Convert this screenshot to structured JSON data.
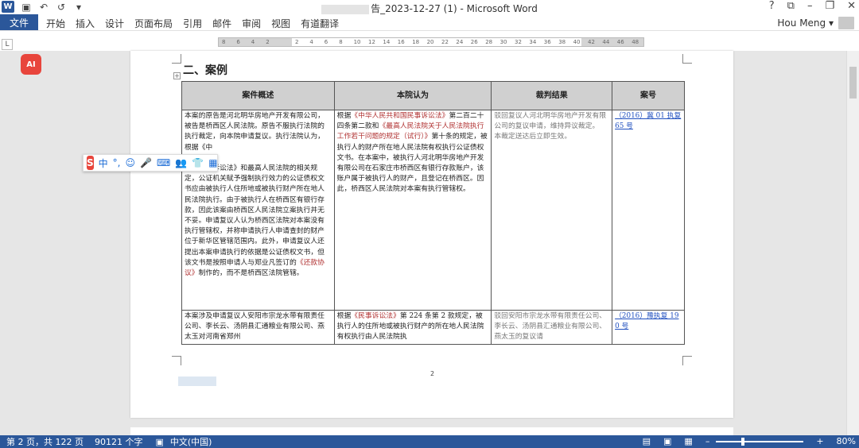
{
  "window": {
    "app_logo": "W",
    "title_suffix": "告_2023-12-27 (1) - Microsoft Word",
    "help": "?",
    "controls": [
      "⧉",
      "–",
      "❐",
      "✕"
    ]
  },
  "qat": {
    "save_icon": "💾",
    "undo": "↶",
    "redo": "↺",
    "more": "▾"
  },
  "ribbon": {
    "file_tab": "文件",
    "tabs": [
      "开始",
      "插入",
      "设计",
      "页面布局",
      "引用",
      "邮件",
      "审阅",
      "视图",
      "有道翻译"
    ],
    "user_name": "Hou Meng ▾"
  },
  "ruler": {
    "corner": "L",
    "ticks": [
      "8",
      "6",
      "4",
      "2",
      "",
      "2",
      "4",
      "6",
      "8",
      "10",
      "12",
      "14",
      "16",
      "18",
      "20",
      "22",
      "24",
      "26",
      "28",
      "30",
      "32",
      "34",
      "36",
      "38",
      "40",
      "42",
      "44",
      "46",
      "48"
    ]
  },
  "document": {
    "heading": "二、案例",
    "move_handle": "+",
    "table": {
      "headers": [
        "案件概述",
        "本院认为",
        "裁判结果",
        "案号"
      ],
      "rows": [
        {
          "summary_a": "本案的原告是河北明华房地产开发有限公司，被告是桥西区人民法院。原告不服执行法院的执行裁定，向本院申请复议。执行法院认为，根据《中",
          "summary_b": "和国民事诉讼法》和最高人民法院的相关规定，公证机关赋予强制执行效力的公证债权文书应由被执行人住所地或被执行财产所在地人民法院执行。由于被执行人在桥西区有银行存款，因此该案由桥西区人民法院立案执行并无不妥。申请复议人认为桥西区法院对本案没有执行管辖权，并称申请执行人申请查封的财产位于新华区管辖范围内。此外，申请复议人还提出本案申请执行的依据是公证债权文书，但该文书是按照申请人与郑业凡签订的",
          "summary_red": "《还款协议》",
          "summary_c": "制作的，而不是桥西区法院管辖。",
          "opinion_a": "根据",
          "opinion_red1": "《中华人民共和国民事诉讼法》",
          "opinion_b": "第二百二十四条第二款和",
          "opinion_red2": "《最高人民法院关于人民法院执行工作若干问题的规定（试行）》",
          "opinion_c": "第十条的规定，被执行人的财产所在地人民法院有权执行公证债权文书。在本案中，被执行人河北明华房地产开发有限公司在石家庄市桥西区有银行存款账户，该账户属于被执行人的财产，且登记在桥西区。因此，桥西区人民法院对本案有执行管辖权。",
          "result_a": "驳回复议人河北明华房地产开发有限公司的复议申请，维持异议裁定。",
          "result_b": "本裁定送达后立即生效。",
          "case_no": "（2016）冀 01 执复 65 号"
        },
        {
          "summary": "本案涉及申请复议人安阳市宗龙水带有限责任公司、李长云、汤阴县汇通粮业有限公司、燕太玉对河南省郑州",
          "opinion_a": "根据",
          "opinion_red": "《民事诉讼法》",
          "opinion_b": "第 224 条第 2 款规定，被执行人的住所地或被执行财产的所在地人民法院有权执行由人民法院执",
          "result": "驳回安阳市宗龙水带有限责任公司、李长云、汤阴县汇通粮业有限公司、燕太玉的复议请",
          "case_no": "（2016）豫执复 190 号"
        }
      ]
    },
    "page_number": "2"
  },
  "ime": {
    "logo": "S",
    "items": [
      "中",
      "°,",
      "☺",
      "🎤",
      "⌨",
      "👥",
      "👕",
      "▦"
    ]
  },
  "ai_badge": "AI",
  "status": {
    "page": "第 2 页，共 122 页",
    "words": "90121 个字",
    "lang": "中文(中国)",
    "zoom": "80%",
    "zoom_minus": "–",
    "zoom_plus": "+"
  },
  "colors": {
    "word_blue": "#2b579a",
    "table_header": "#d0d0d0",
    "legal_red": "#b03030"
  }
}
